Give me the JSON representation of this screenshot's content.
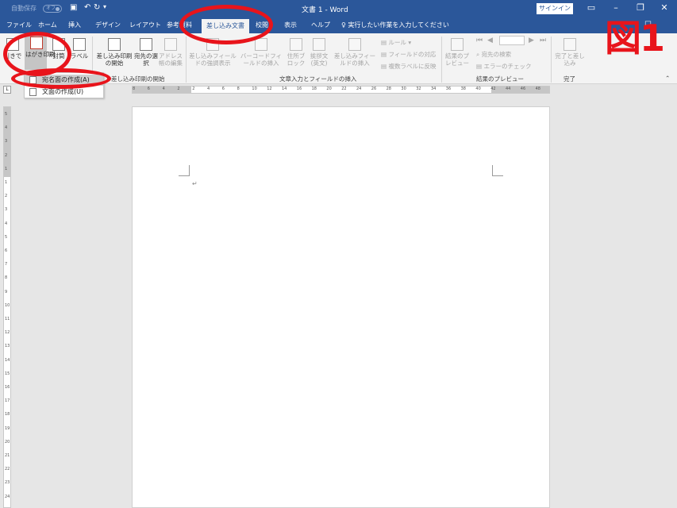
{
  "titlebar": {
    "autosave_label": "自動保存",
    "autosave_state": "オフ",
    "window_title": "文書 1 - Word",
    "signin_label": "サインイン"
  },
  "tabs": [
    {
      "label": "ファイル"
    },
    {
      "label": "ホーム"
    },
    {
      "label": "挿入"
    },
    {
      "label": "デザイン"
    },
    {
      "label": "レイアウト"
    },
    {
      "label": "参考資料"
    },
    {
      "label": "差し込み文書",
      "active": true
    },
    {
      "label": "校閲"
    },
    {
      "label": "表示"
    },
    {
      "label": "ヘルプ"
    }
  ],
  "tell_me": "実行したい作業を入力してください",
  "ribbon": {
    "create_group": {
      "envelope_label": "封筒",
      "postcard_label": "はがき印刷",
      "envelope2_label": "封筒",
      "label_label": "ラベル",
      "left_label": "引きで"
    },
    "start_group": {
      "start_merge": "差し込み印刷の開始",
      "select_recipients": "宛先の選択",
      "edit_list": "アドレス帳の編集",
      "group_label": "差し込み印刷の開始"
    },
    "fields_group": {
      "highlight_fields": "差し込みフィールドの強調表示",
      "barcode_field": "バーコードフィールドの挿入",
      "address_block": "住所ブロック",
      "greeting_line": "挨拶文(英文)",
      "insert_field": "差し込みフィールドの挿入",
      "rules": "ルール",
      "match_fields": "フィールドの対応",
      "update_labels": "複数ラベルに反映",
      "group_label": "文章入力とフィールドの挿入"
    },
    "preview_group": {
      "preview_results": "結果のプレビュー",
      "find_recipient": "宛先の検索",
      "check_errors": "エラーのチェック",
      "group_label": "結果のプレビュー"
    },
    "finish_group": {
      "finish_merge": "完了と差し込み",
      "group_label": "完了"
    }
  },
  "dropdown": {
    "items": [
      {
        "label": "宛名面の作成(A)",
        "highlighted": true
      },
      {
        "label": "文面の作成(U)",
        "highlighted": false
      }
    ]
  },
  "ruler": {
    "h_labels": [
      "8",
      "6",
      "4",
      "2",
      "2",
      "4",
      "6",
      "8",
      "10",
      "12",
      "14",
      "16",
      "18",
      "20",
      "22",
      "24",
      "26",
      "28",
      "30",
      "32",
      "34",
      "36",
      "38",
      "40",
      "42",
      "44",
      "46",
      "48"
    ],
    "v_labels": [
      "5",
      "4",
      "3",
      "2",
      "1",
      "1",
      "2",
      "3",
      "4",
      "5",
      "6",
      "7",
      "8",
      "9",
      "10",
      "11",
      "12",
      "13",
      "14",
      "15",
      "16",
      "17",
      "18",
      "19",
      "20",
      "21",
      "22",
      "23",
      "24",
      "25"
    ]
  },
  "annotation": {
    "figure_label": "図1",
    "color": "#e8141b"
  },
  "colors": {
    "word_blue": "#2b579a"
  }
}
